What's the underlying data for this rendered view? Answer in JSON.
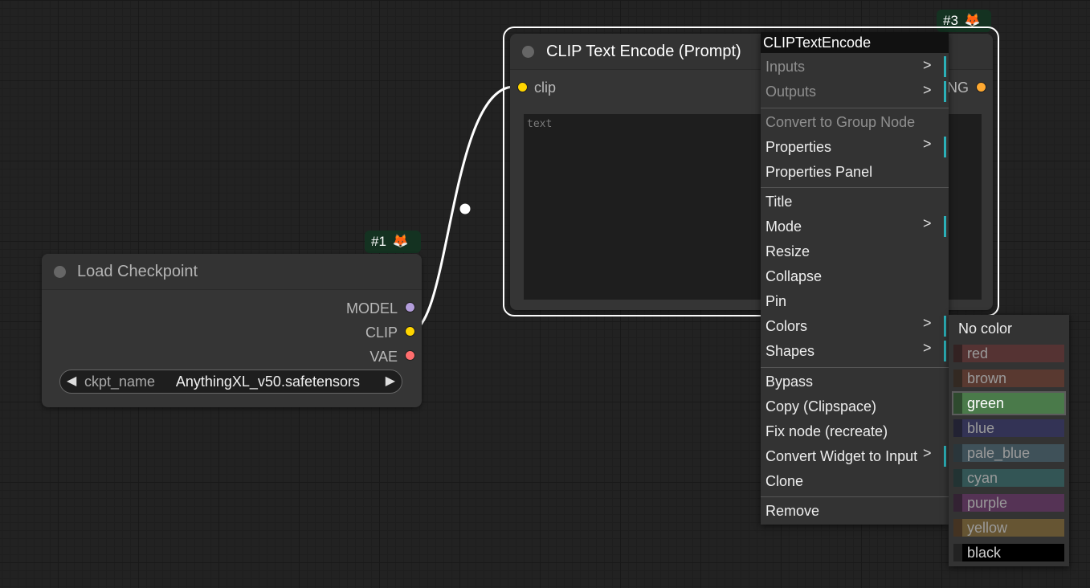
{
  "canvas": {
    "background": "#222222"
  },
  "load_checkpoint_node": {
    "badge_number": "#1",
    "badge_icon": "fox-icon",
    "title": "Load Checkpoint",
    "outputs": [
      {
        "label": "MODEL",
        "color": "#b39ddb"
      },
      {
        "label": "CLIP",
        "color": "#ffd500"
      },
      {
        "label": "VAE",
        "color": "#ff6e6e"
      }
    ],
    "widget": {
      "name": "ckpt_name",
      "value": "AnythingXL_v50.safetensors",
      "left_arrow": "◀",
      "right_arrow": "▶"
    }
  },
  "clip_text_encode_node": {
    "badge_number": "#3",
    "badge_icon": "fox-icon",
    "title": "CLIP Text Encode (Prompt)",
    "input_label": "clip",
    "input_color": "#ffd500",
    "output_label_visible": "NG",
    "output_color": "#ffa931",
    "textarea_placeholder": "text"
  },
  "context_menu": {
    "title": "CLIPTextEncode",
    "items": [
      {
        "label": "Inputs",
        "disabled": true,
        "submenu": true
      },
      {
        "label": "Outputs",
        "disabled": true,
        "submenu": true
      },
      {
        "label": "Convert to Group Node",
        "disabled": true,
        "submenu": false
      },
      {
        "label": "Properties",
        "disabled": false,
        "submenu": true
      },
      {
        "label": "Properties Panel",
        "disabled": false,
        "submenu": false
      },
      {
        "label": "Title",
        "disabled": false,
        "submenu": false
      },
      {
        "label": "Mode",
        "disabled": false,
        "submenu": true
      },
      {
        "label": "Resize",
        "disabled": false,
        "submenu": false
      },
      {
        "label": "Collapse",
        "disabled": false,
        "submenu": false
      },
      {
        "label": "Pin",
        "disabled": false,
        "submenu": false
      },
      {
        "label": "Colors",
        "disabled": false,
        "submenu": true
      },
      {
        "label": "Shapes",
        "disabled": false,
        "submenu": true
      },
      {
        "label": "Bypass",
        "disabled": false,
        "submenu": false
      },
      {
        "label": "Copy (Clipspace)",
        "disabled": false,
        "submenu": false
      },
      {
        "label": "Fix node (recreate)",
        "disabled": false,
        "submenu": false
      },
      {
        "label": "Convert Widget to Input",
        "disabled": false,
        "submenu": true
      },
      {
        "label": "Clone",
        "disabled": false,
        "submenu": false
      },
      {
        "label": "Remove",
        "disabled": false,
        "submenu": false
      }
    ],
    "submenu_arrow": ">"
  },
  "colors_submenu": {
    "no_color_label": "No color",
    "options": [
      {
        "label": "red",
        "bg": "#553333",
        "swatch": "#332222"
      },
      {
        "label": "brown",
        "bg": "#593930",
        "swatch": "#332922"
      },
      {
        "label": "green",
        "bg": "#335533",
        "swatch": "#223322",
        "highlighted": true
      },
      {
        "label": "blue",
        "bg": "#335",
        "swatch": "#223"
      },
      {
        "label": "pale_blue",
        "bg": "#3f5159",
        "swatch": "#2a363b"
      },
      {
        "label": "cyan",
        "bg": "#355",
        "swatch": "#233"
      },
      {
        "label": "purple",
        "bg": "#535",
        "swatch": "#323"
      },
      {
        "label": "yellow",
        "bg": "#653",
        "swatch": "#432"
      },
      {
        "label": "black",
        "bg": "#000000",
        "swatch": "#222222"
      }
    ]
  }
}
